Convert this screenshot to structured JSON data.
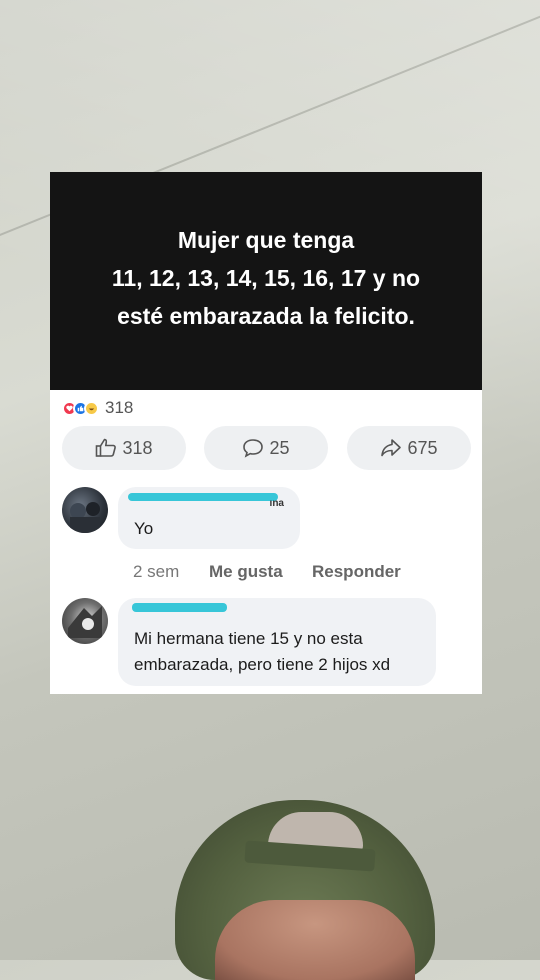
{
  "post": {
    "text_lines": [
      "Mujer que tenga",
      "11, 12, 13, 14, 15, 16, 17 y no",
      "esté embarazada la felicito."
    ],
    "reaction_count": "318",
    "reaction_icons": [
      "love-icon",
      "like-icon",
      "haha-icon"
    ],
    "actions": {
      "like_count": "318",
      "comment_count": "25",
      "share_count": "675"
    }
  },
  "comments": [
    {
      "name_fragment": "ına",
      "text": "Yo",
      "time": "2 sem",
      "like_label": "Me gusta",
      "reply_label": "Responder"
    },
    {
      "text_lines": [
        "Mi hermana tiene 15 y no esta",
        "embarazada, pero tiene 2 hijos xd"
      ]
    }
  ],
  "colors": {
    "banner": "#141414",
    "bubble": "#f0f2f5",
    "name_redaction": "#37c6d8",
    "hat": "#53603f"
  }
}
